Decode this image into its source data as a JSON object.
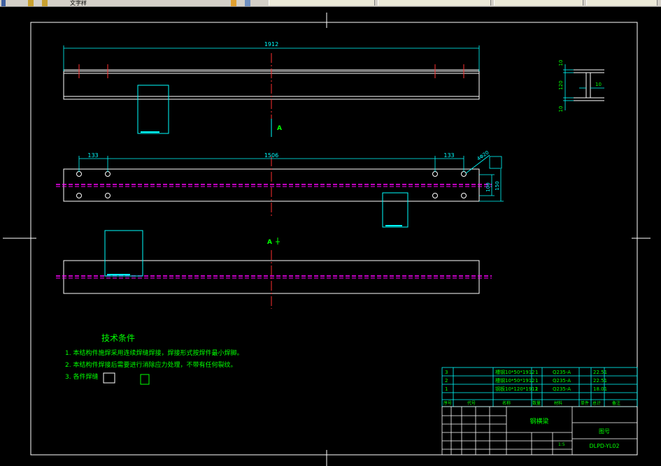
{
  "toolbar": {
    "left_item": "文字样",
    "tabs": [
      "",
      "",
      "",
      ""
    ]
  },
  "drawing": {
    "top_view": {
      "length_dim": "1912"
    },
    "front_view": {
      "dim_left": "133",
      "dim_center": "1506",
      "dim_right": "133",
      "hole_label": "4Φ20",
      "height_inner": "100",
      "height_outer": "150"
    },
    "section_label": "A",
    "section_mark": "A",
    "profile": {
      "flange_top": "10",
      "web_height": "120",
      "flange_bottom": "10",
      "web_thickness": "10"
    },
    "notes": {
      "title": "技术条件",
      "items": [
        "1. 本结构件施焊采用连续焊缝焊接，焊接形式按焊件最小焊脚。",
        "2. 本结构件焊接后需要进行消除应力处理，不带有任何裂纹。",
        "3. 各件焊缝"
      ]
    },
    "bom": {
      "rows": [
        {
          "no": "3",
          "name": "槽钢10*50*1912",
          "qty": "1",
          "material": "Q235-A",
          "weight": "22.51"
        },
        {
          "no": "2",
          "name": "槽钢10*50*1912",
          "qty": "1",
          "material": "Q235-A",
          "weight": "22.51"
        },
        {
          "no": "1",
          "name": "钢板10*120*1912",
          "qty": "1",
          "material": "Q235-A",
          "weight": "18.01"
        }
      ],
      "header": [
        "序号",
        "代号",
        "名称",
        "数量",
        "材料",
        "单件",
        "总计",
        "备注"
      ]
    },
    "title_block": {
      "part_name": "钢横梁",
      "company": "图号",
      "drawing_no": "DLPD-YL02",
      "scale": "1:5"
    }
  }
}
